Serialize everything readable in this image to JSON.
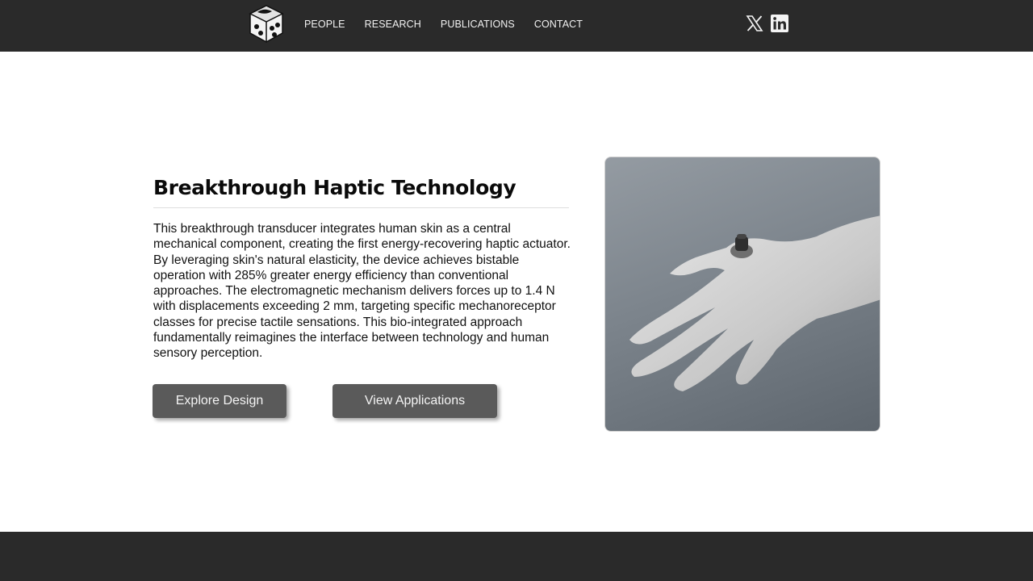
{
  "nav": {
    "items": [
      "PEOPLE",
      "RESEARCH",
      "PUBLICATIONS",
      "CONTACT"
    ]
  },
  "social": {
    "x_icon": "x-logo-icon",
    "linkedin_icon": "linkedin-icon"
  },
  "hero": {
    "title": "Breakthrough Haptic Technology",
    "body": "This breakthrough transducer integrates human skin as a central mechanical component, creating the first energy-recovering haptic actuator. By leveraging skin's natural elasticity, the device achieves bistable operation with 285% greater energy efficiency than conventional approaches. The electromagnetic mechanism delivers forces up to 1.4 N with displacements exceeding 2 mm, targeting specific mechanoreceptor classes for precise tactile sensations. This bio-integrated approach fundamentally reimagines the interface between technology and human sensory perception.",
    "buttons": {
      "explore": "Explore Design",
      "applications": "View Applications"
    }
  },
  "colors": {
    "bar": "#2a2a2a",
    "button": "#5a5a5a",
    "photo_bg": "#7c848c"
  }
}
